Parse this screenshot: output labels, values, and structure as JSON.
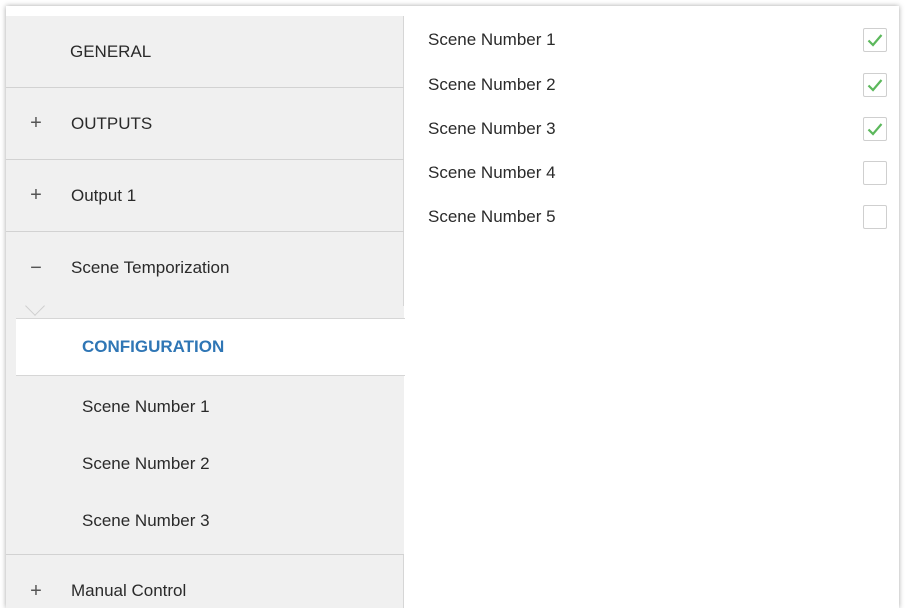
{
  "sidebar": {
    "items": [
      {
        "label": "GENERAL",
        "symbol": ""
      },
      {
        "label": "OUTPUTS",
        "symbol": "+"
      },
      {
        "label": "Output 1",
        "symbol": "+"
      },
      {
        "label": "Scene Temporization",
        "symbol": "−"
      }
    ],
    "subitems": [
      {
        "label": "CONFIGURATION",
        "active": true
      },
      {
        "label": "Scene Number 1"
      },
      {
        "label": "Scene Number 2"
      },
      {
        "label": "Scene Number 3"
      }
    ],
    "bottom_item": {
      "label": "Manual Control",
      "symbol": "+"
    }
  },
  "content": {
    "rows": [
      {
        "label": "Scene Number 1",
        "checked": true
      },
      {
        "label": "Scene Number 2",
        "checked": true
      },
      {
        "label": "Scene Number 3",
        "checked": true
      },
      {
        "label": "Scene Number 4",
        "checked": false
      },
      {
        "label": "Scene Number 5",
        "checked": false
      }
    ]
  },
  "colors": {
    "accent": "#2f76b5",
    "check": "#5cb85c",
    "sidebar_bg": "#f0f0f0"
  },
  "icons": {
    "expand": "plus-icon",
    "collapse": "minus-icon",
    "checked": "checkmark-icon"
  }
}
